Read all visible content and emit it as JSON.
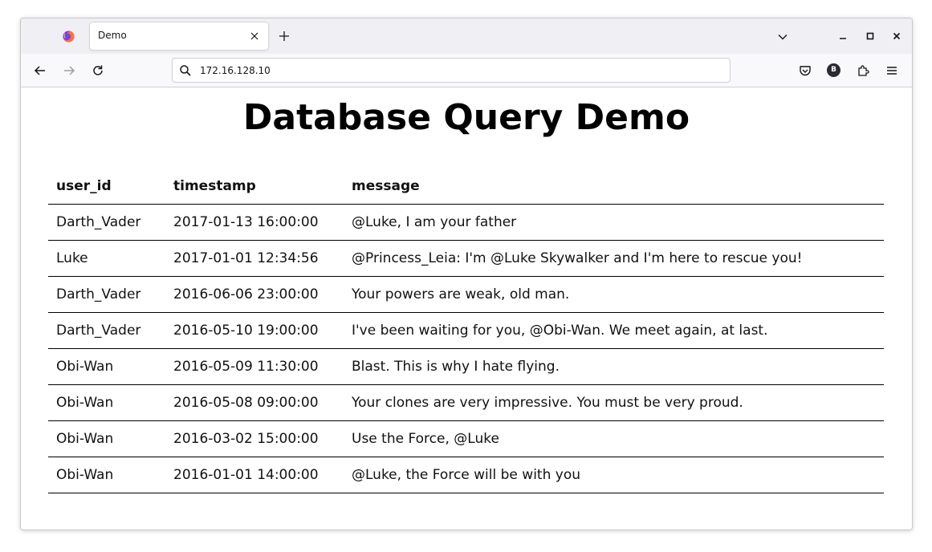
{
  "browser": {
    "tab": {
      "title": "Demo",
      "icons": {
        "favicon": "firefox-logo",
        "close": "close-icon",
        "new_tab": "plus-icon"
      }
    },
    "urlbar": {
      "url": "172.16.128.10"
    },
    "profile_initial": "B",
    "colors": {
      "tabstrip_bg": "#f0f0f4",
      "navbar_bg": "#f9f9fb",
      "tab_bg": "#ffffff"
    }
  },
  "page": {
    "title": "Database Query Demo",
    "table": {
      "columns": [
        "user_id",
        "timestamp",
        "message"
      ],
      "rows": [
        [
          "Darth_Vader",
          "2017-01-13 16:00:00",
          "@Luke, I am your father"
        ],
        [
          "Luke",
          "2017-01-01 12:34:56",
          "@Princess_Leia: I'm @Luke Skywalker and I'm here to rescue you!"
        ],
        [
          "Darth_Vader",
          "2016-06-06 23:00:00",
          "Your powers are weak, old man."
        ],
        [
          "Darth_Vader",
          "2016-05-10 19:00:00",
          "I've been waiting for you, @Obi-Wan. We meet again, at last."
        ],
        [
          "Obi-Wan",
          "2016-05-09 11:30:00",
          "Blast. This is why I hate flying."
        ],
        [
          "Obi-Wan",
          "2016-05-08 09:00:00",
          "Your clones are very impressive. You must be very proud."
        ],
        [
          "Obi-Wan",
          "2016-03-02 15:00:00",
          "Use the Force, @Luke"
        ],
        [
          "Obi-Wan",
          "2016-01-01 14:00:00",
          "@Luke, the Force will be with you"
        ]
      ]
    }
  }
}
